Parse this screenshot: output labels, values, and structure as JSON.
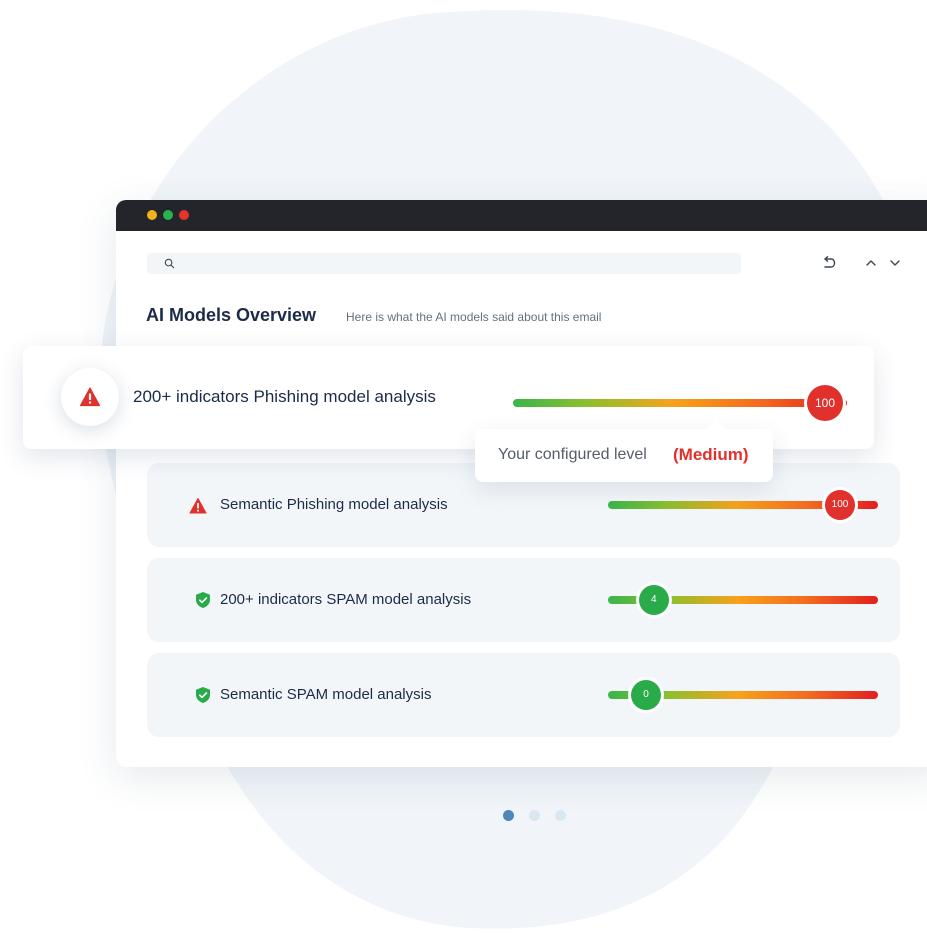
{
  "colors": {
    "background_blob": "#f1f5f9",
    "titlebar": "#23252b",
    "text_primary": "#1c2b48",
    "text_secondary": "#66707c",
    "danger": "#e0312d",
    "safe": "#2aab4a",
    "pager_active": "#4f86b8",
    "pager_inactive": "#d9e7f2"
  },
  "window": {
    "controls": [
      {
        "name": "minimize-dot",
        "color": "#f2b21c"
      },
      {
        "name": "maximize-dot",
        "color": "#25b44e"
      },
      {
        "name": "close-dot",
        "color": "#e8332d"
      }
    ]
  },
  "search": {
    "placeholder": "",
    "value": ""
  },
  "toolbar": {
    "icons": [
      "undo-icon",
      "chevron-up-icon",
      "chevron-down-icon"
    ]
  },
  "header": {
    "title": "AI Models Overview",
    "subtitle": "Here is what the AI models said about this email"
  },
  "featured": {
    "icon": "warning-icon",
    "label": "200+ indicators Phishing model analysis",
    "score": "100",
    "fill_fraction": 1.0,
    "status": "danger"
  },
  "tooltip": {
    "text": "Your configured level",
    "level": "(Medium)"
  },
  "rows": [
    {
      "icon": "warning-icon",
      "label": "Semantic Phishing model analysis",
      "score": "100",
      "fill_fraction": 1.0,
      "status": "danger"
    },
    {
      "icon": "shield-check-icon",
      "label": "200+ indicators SPAM model analysis",
      "score": "4",
      "fill_fraction": 0.04,
      "status": "safe"
    },
    {
      "icon": "shield-check-icon",
      "label": "Semantic SPAM model analysis",
      "score": "0",
      "fill_fraction": 0.0,
      "status": "safe"
    }
  ],
  "pager": {
    "pages": 3,
    "current_page": 1
  }
}
